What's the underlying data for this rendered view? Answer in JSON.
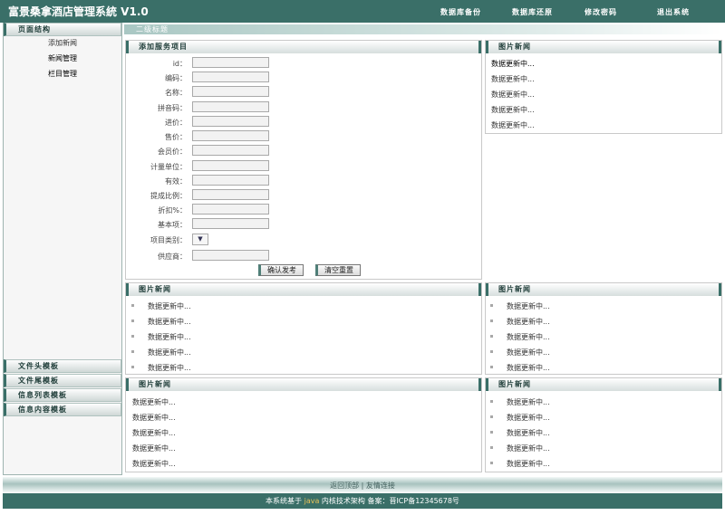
{
  "header": {
    "title": "富景桑拿酒店管理系統 V1.0",
    "menu": [
      "数据库备份",
      "数据库还原",
      "修改密码",
      "退出系统"
    ]
  },
  "sidebar": {
    "page_structure": {
      "title": "页面结构",
      "links": [
        "添加新闻",
        "新闻管理",
        "栏目管理"
      ]
    },
    "templates": [
      "文件头模板",
      "文件尾模板",
      "信息列表模板",
      "信息内容模板"
    ]
  },
  "section": {
    "title": "二级标题"
  },
  "form": {
    "title": "添加服务项目",
    "fields": [
      {
        "label": "id：",
        "value": ""
      },
      {
        "label": "编码：",
        "value": ""
      },
      {
        "label": "名称：",
        "value": ""
      },
      {
        "label": "拼音码：",
        "value": ""
      },
      {
        "label": "进价：",
        "value": ""
      },
      {
        "label": "售价：",
        "value": ""
      },
      {
        "label": "会员价：",
        "value": ""
      },
      {
        "label": "计量单位：",
        "value": ""
      },
      {
        "label": "有效：",
        "value": ""
      },
      {
        "label": "提成比例：",
        "value": ""
      },
      {
        "label": "折扣%：",
        "value": ""
      },
      {
        "label": "基本项：",
        "value": ""
      }
    ],
    "category_label": "项目类别：",
    "category_value": "",
    "supplier_label": "供应商：",
    "supplier_value": "",
    "submit_label": "确认发考",
    "reset_label": "清空重置"
  },
  "panels": {
    "title": "图片新闻",
    "item_text": "数据更新中..."
  },
  "footer": {
    "links": "返回顶部 | 友情连接",
    "text_before": "本系统基于",
    "java": "java",
    "text_after": "内核技术架构  备案：晋ICP备12345678号"
  },
  "colors": {
    "header_bg": "#3a6f68",
    "footer_bg": "#3a6f68",
    "panel_accent": "#3a6f68"
  }
}
